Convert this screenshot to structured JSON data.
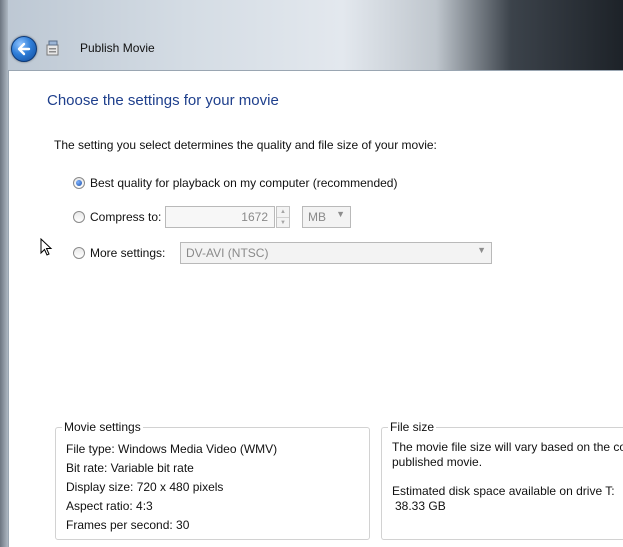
{
  "window": {
    "title": "Publish Movie"
  },
  "page": {
    "heading": "Choose the settings for your movie",
    "description": "The setting you select determines the quality and file size of your movie:"
  },
  "options": {
    "best_quality_label": "Best quality for playback on my computer (recommended)",
    "compress_label": "Compress to:",
    "compress_value": "1672",
    "compress_unit": "MB",
    "more_settings_label": "More settings:",
    "more_settings_value": "DV-AVI (NTSC)",
    "selected": "best_quality"
  },
  "movie_settings": {
    "legend": "Movie settings",
    "lines": [
      "File type: Windows Media Video (WMV)",
      "Bit rate: Variable bit rate",
      "Display size: 720 x 480 pixels",
      "Aspect ratio: 4:3",
      "Frames per second: 30"
    ]
  },
  "file_size": {
    "legend": "File size",
    "message_line1": "The movie file size will vary based on the co",
    "message_line2": "published movie.",
    "disk_label": "Estimated disk space available on drive T:",
    "disk_value": "38.33 GB"
  },
  "icons": {
    "back": "back-arrow-icon",
    "app": "movie-maker-icon",
    "cursor": "mouse-pointer-icon"
  },
  "colors": {
    "heading": "#1e3f8c",
    "back_button": "#2f7ed8"
  }
}
